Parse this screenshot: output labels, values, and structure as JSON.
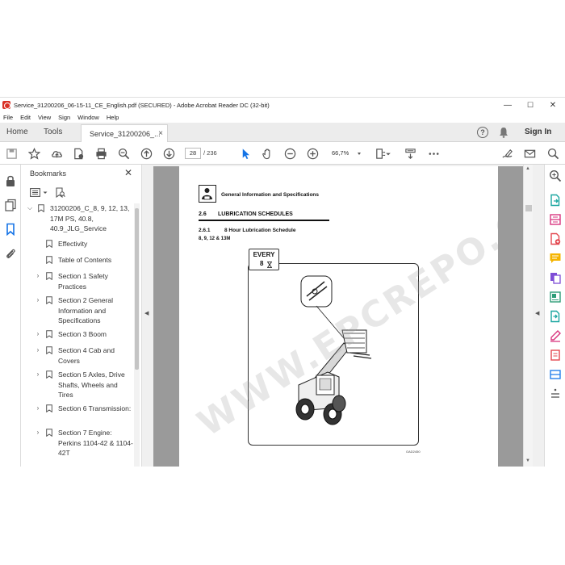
{
  "window": {
    "title": "Service_31200206_06-15-11_CE_English.pdf (SECURED) - Adobe Acrobat Reader DC (32-bit)",
    "minimize": "—",
    "maximize": "☐",
    "close": "✕"
  },
  "menu": [
    "File",
    "Edit",
    "View",
    "Sign",
    "Window",
    "Help"
  ],
  "tabs": {
    "home": "Home",
    "tools": "Tools",
    "document": "Service_31200206_...",
    "close": "×"
  },
  "header": {
    "help": "?",
    "sign_in": "Sign In"
  },
  "toolbar": {
    "current_page": "28",
    "total_pages": "/ 236",
    "zoom": "66,7%"
  },
  "bookmarks": {
    "title": "Bookmarks",
    "close": "✕",
    "items": [
      {
        "level": 0,
        "expand": "collapse",
        "text": "31200206_C_8, 9, 12, 13, 17M PS, 40.8, 40.9_JLG_Service"
      },
      {
        "level": 1,
        "expand": "none",
        "text": "Effectivity"
      },
      {
        "level": 1,
        "expand": "none",
        "text": "Table of Contents"
      },
      {
        "level": 1,
        "expand": "expand",
        "text": "Section 1 Safety Practices"
      },
      {
        "level": 1,
        "expand": "expand",
        "text": "Section 2 General Information and Specifications"
      },
      {
        "level": 1,
        "expand": "expand",
        "text": "Section 3 Boom"
      },
      {
        "level": 1,
        "expand": "expand",
        "text": "Section 4 Cab and Covers"
      },
      {
        "level": 1,
        "expand": "expand",
        "text": "Section 5 Axles, Drive Shafts, Wheels and Tires"
      },
      {
        "level": 1,
        "expand": "expand",
        "text": "Section 6 Transmission:"
      },
      {
        "level": 1,
        "expand": "expand",
        "text": "Section 7 Engine: Perkins 1104-42 & 1104-42T"
      }
    ]
  },
  "document": {
    "header": "General Information and Specifications",
    "section_number": "2.6",
    "section_title": "LUBRICATION SCHEDULES",
    "subsection_number": "2.6.1",
    "subsection_title": "8 Hour Lubrication Schedule",
    "models": "8, 9, 12 & 13M",
    "every_label": "EVERY",
    "every_hours": "8",
    "figure_code": "OAD2450",
    "watermark": "WWW.EPCREPO.COM"
  },
  "colors": {
    "accent_blue": "#1473e6",
    "viewer_gray": "#9a9a9a",
    "acrobat_red": "#d93025"
  }
}
